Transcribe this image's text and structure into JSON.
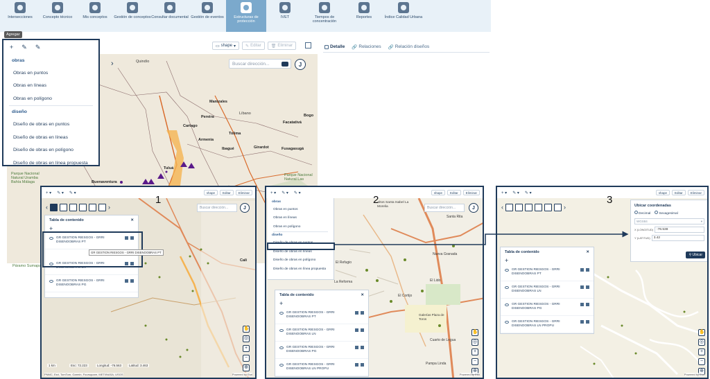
{
  "nav": {
    "items": [
      {
        "label": "Intersecciones",
        "icon": "intersections-icon"
      },
      {
        "label": "Concepto técnico",
        "icon": "technical-concept-icon"
      },
      {
        "label": "Mis conceptos",
        "icon": "my-concepts-icon"
      },
      {
        "label": "Gestión de conceptos",
        "icon": "concept-management-icon"
      },
      {
        "label": "Consultar documental",
        "icon": "documents-icon"
      },
      {
        "label": "Gestión de eventos",
        "icon": "events-icon"
      },
      {
        "label": "Estructuras de protección",
        "icon": "structures-icon",
        "active": true
      },
      {
        "label": "IVET",
        "icon": "ivet-icon"
      },
      {
        "label": "Tiempos de concentración",
        "icon": "timer-icon"
      },
      {
        "label": "Reportes",
        "icon": "reports-icon"
      },
      {
        "label": "Índice Calidad Urbana",
        "icon": "quality-index-icon"
      }
    ]
  },
  "tooltip": "Agregar",
  "dropdown": {
    "toolbar": [
      "+",
      "✎",
      "✎"
    ],
    "sections": [
      {
        "title": "obras",
        "items": [
          "Obras en puntos",
          "Obras en líneas",
          "Obras en polígono"
        ]
      },
      {
        "title": "diseño",
        "items": [
          "Diseño de obras en puntos",
          "Diseño de obras en líneas",
          "Diseño de obras en polígono",
          "Diseño de obras en línea propuesta"
        ]
      }
    ]
  },
  "toolbar": {
    "shape": "shape",
    "edit": "Editar",
    "delete": "Eliminar"
  },
  "search": {
    "placeholder": "Buscar dirección..."
  },
  "map_button": "J",
  "right_tabs": {
    "detail": "Detalle",
    "relations": "Relaciones",
    "design_relations": "Relación diseños"
  },
  "map_labels": {
    "quindio": "Quindío",
    "manizales": "Manizales",
    "pereira": "Pereira",
    "libano": "Líbano",
    "cartago": "Cartago",
    "armenia": "Armenia",
    "ibague": "Ibagué",
    "tolima": "Tolima",
    "girardot": "Girardot",
    "facatativa": "Facatativá",
    "bogota": "Bogo",
    "fusagasuga": "Fusagasugá",
    "tulua": "Tuluá",
    "buenaventura": "Buenaventura",
    "park1": "Parque Nacional Natural Uramba Bahía Málaga",
    "park2": "Parque Nacional Natural Las",
    "paramo": "Páramo Sumapaz",
    "cali": "Cali"
  },
  "steps": {
    "one": "1",
    "two": "2",
    "three": "3"
  },
  "toc": {
    "title": "Tabla de contenido",
    "items_p1": [
      {
        "label": "GR GESTION RIESGOS - GRRI DISENOOBRAS PT",
        "highlight": true
      },
      {
        "label": "GR GESTION RIESGOS - GRRI DISENOOBRAS LN"
      },
      {
        "label": "GR GESTION RIESGOS - GRRI DISENOOBRAS PG"
      }
    ],
    "tooltip_p1": "GR GESTION RIESGOS - GRRI DISENOOBRAS PT",
    "items_p2": [
      {
        "label": "GR GESTION RIESGOS - GRRI DISENOOBRAS PT"
      },
      {
        "label": "GR GESTION RIESGOS - GRRI DISENOOBRAS LN"
      },
      {
        "label": "GR GESTION RIESGOS - GRRI DISENOOBRAS PG"
      },
      {
        "label": "GR GESTION RIESGOS - GRRI DISENOOBRAS LN PROPU"
      }
    ],
    "items_p3": [
      {
        "label": "GR GESTION RIESGOS - GRRI DISENOOBRAS PT"
      },
      {
        "label": "GR GESTION RIESGOS - GRRI DISENOOBRAS LN"
      },
      {
        "label": "GR GESTION RIESGOS - GRRI DISENOOBRAS PG"
      },
      {
        "label": "GR GESTION RIESGOS - GRRI DISENOOBRAS LN PROPU"
      }
    ]
  },
  "p2_labels": {
    "zona": "Altos Santa Isabel La Morelia",
    "nueva_granada": "Nueva Granada",
    "lido": "El Lido",
    "cortijo": "El Cortijo",
    "refugio": "El Refugio",
    "la_reforma": "La Reforma",
    "pampa": "Pampa Linda",
    "cuarto": "Cuarto de Legua",
    "gal": "Galerías Plaza de Toros",
    "santa": "Santa Rita"
  },
  "coords": {
    "title": "Ubicar coordenadas",
    "decimal": "Decimal",
    "sexagesimal": "Sexagesimal",
    "system_placeholder": "WGS84",
    "lon_label": "X (LONGITUD)",
    "lon_value": "-76.538",
    "lat_label": "Y (LATITUD)",
    "lat_value": "3.42",
    "locate": "Ubicar"
  },
  "scale": {
    "p1": "1 km",
    "p1_lon": "Longitud: -76.563",
    "p1_lat": "Latitud: 3.463",
    "p1_esc": "Esc: 72.223"
  },
  "attribution": {
    "p1": "PNMC, Esri, TomTom, Garmin, Foursquare, METI/NASA, USGS",
    "powered": "Powered by Esri"
  }
}
